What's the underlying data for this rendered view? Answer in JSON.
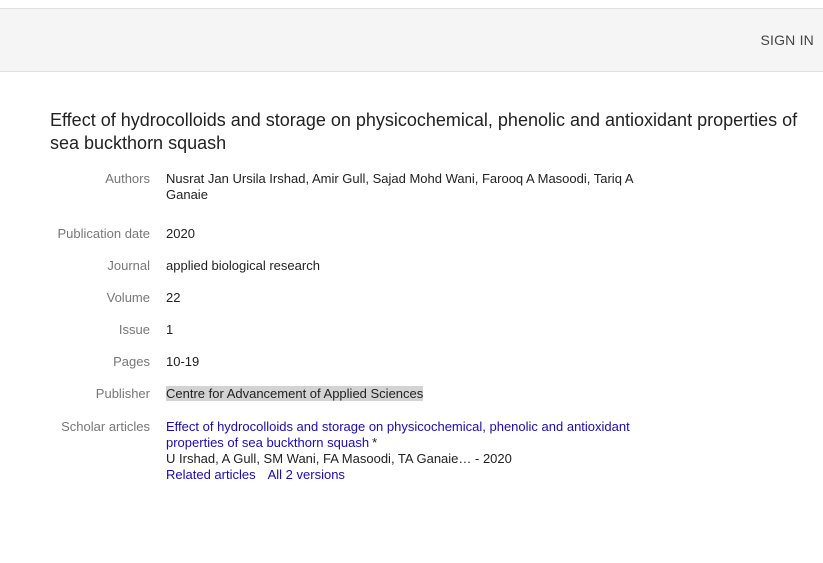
{
  "header": {
    "sign_in": "SIGN IN"
  },
  "article": {
    "title": "Effect of hydrocolloids and storage on physicochemical, phenolic and antioxidant properties of sea buckthorn squash"
  },
  "fields": {
    "authors": {
      "label": "Authors",
      "value": "Nusrat Jan Ursila Irshad, Amir Gull, Sajad Mohd Wani, Farooq A Masoodi, Tariq A Ganaie"
    },
    "publication_date": {
      "label": "Publication date",
      "value": "2020"
    },
    "journal": {
      "label": "Journal",
      "value": "applied biological research"
    },
    "volume": {
      "label": "Volume",
      "value": "22"
    },
    "issue": {
      "label": "Issue",
      "value": "1"
    },
    "pages": {
      "label": "Pages",
      "value": "10-19"
    },
    "publisher": {
      "label": "Publisher",
      "value": "Centre for Advancement of Applied Sciences"
    },
    "scholar_articles": {
      "label": "Scholar articles",
      "title_link": "Effect of hydrocolloids and storage on physicochemical, phenolic and antioxidant properties of sea buckthorn squash",
      "star": "*",
      "meta": "U Irshad, A Gull, SM Wani, FA Masoodi, TA Ganaie… - 2020",
      "related_articles": "Related articles",
      "all_versions": "All 2 versions"
    }
  },
  "colors": {
    "link": "#1a0dab",
    "label": "#777777",
    "header_bg": "#f5f5f5",
    "highlight": "#d3d3d3"
  }
}
